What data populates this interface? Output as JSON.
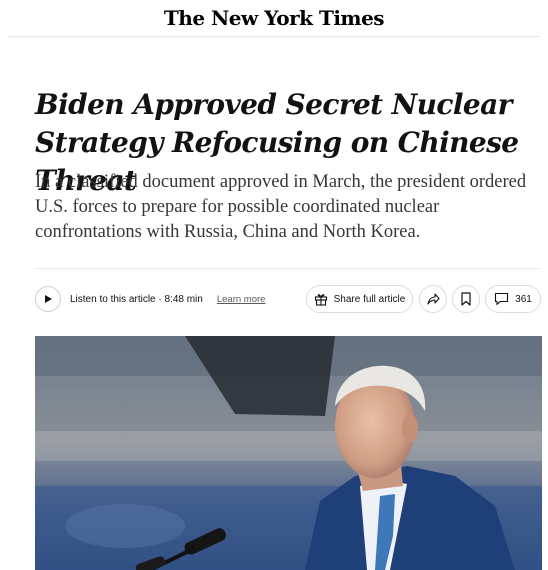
{
  "masthead": {
    "title": "The New York Times"
  },
  "article": {
    "headline": "Biden Approved Secret Nuclear Strategy Refocusing on Chinese Threat",
    "summary": "In a classified document approved in March, the president ordered U.S. forces to prepare for possible coordinated nuclear confrontations with Russia, China and North Korea."
  },
  "toolbar": {
    "listen_label": "Listen to this article · 8:48 min",
    "learn_more": "Learn more",
    "share_full_label": "Share full article",
    "comments_count": "361"
  },
  "icons": {
    "play": "play-icon",
    "gift": "gift-icon",
    "share": "share-arrow-icon",
    "bookmark": "bookmark-icon",
    "comment": "comment-icon"
  },
  "colors": {
    "text": "#121212",
    "summary": "#363636",
    "suit": "#1f3f78",
    "background_blue": "#3d5a8a"
  }
}
